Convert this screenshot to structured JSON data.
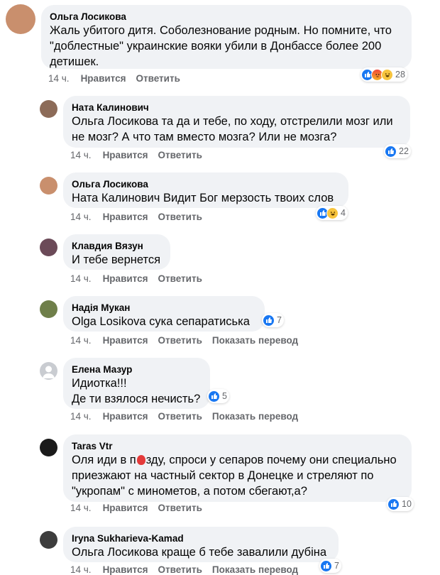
{
  "labels": {
    "like": "Нравится",
    "reply": "Ответить",
    "translate": "Показать перевод"
  },
  "colors": {
    "bubble": "#f0f2f5",
    "meta_text": "#65676b",
    "like_blue": "#1877f2"
  },
  "comments": [
    {
      "author": "Ольга Лосикова",
      "text": "Жаль убитого дитя. Соболезнование родным. Но помните, что\n\"доблестные\" украинские вояки убили в Донбассе более 200\nдетишек.",
      "time": "14 ч.",
      "reactions": [
        "like",
        "angry",
        "haha"
      ],
      "reaction_count": "28"
    },
    {
      "author": "Ната Калинович",
      "text": "Ольга Лосикова та да и тебе, по ходу, отстрелили мозг или\nне мозг?  А что там вместо мозга? Или не мозга?",
      "time": "14 ч.",
      "reactions": [
        "like"
      ],
      "reaction_count": "22"
    },
    {
      "author": "Ольга Лосикова",
      "text": "Ната Калинович Видит Бог мерзость твоих слов",
      "time": "14 ч.",
      "reactions": [
        "like",
        "haha"
      ],
      "reaction_count": "4"
    },
    {
      "author": "Клавдия Вязун",
      "text": "И тебе вернется",
      "time": "14 ч."
    },
    {
      "author": "Надія Мукан",
      "text": "Olga  Losikova сука сепаратиська",
      "time": "14 ч.",
      "reactions": [
        "like"
      ],
      "reaction_count": "7"
    },
    {
      "author": "Елена Мазур",
      "text": "Идиотка!!!\nДе ти взялося нечисть?",
      "time": "14 ч.",
      "reactions": [
        "like"
      ],
      "reaction_count": "5"
    },
    {
      "author": "Taras Vtr",
      "text_a": "Оля иди в п",
      "text_b": "зду, спроси у сепаров почему они специально\nприезжают на частный сектор в Донецке и стреляют по\n\"укропам\" с минометов, а потом сбегают,а?",
      "time": "14 ч.",
      "reactions": [
        "like"
      ],
      "reaction_count": "10"
    },
    {
      "author": "Iryna Sukharieva-Kamad",
      "text": "Ольга Лосикова краще б тебе завалили дубіна",
      "time": "14 ч.",
      "reactions": [
        "like"
      ],
      "reaction_count": "7"
    }
  ]
}
